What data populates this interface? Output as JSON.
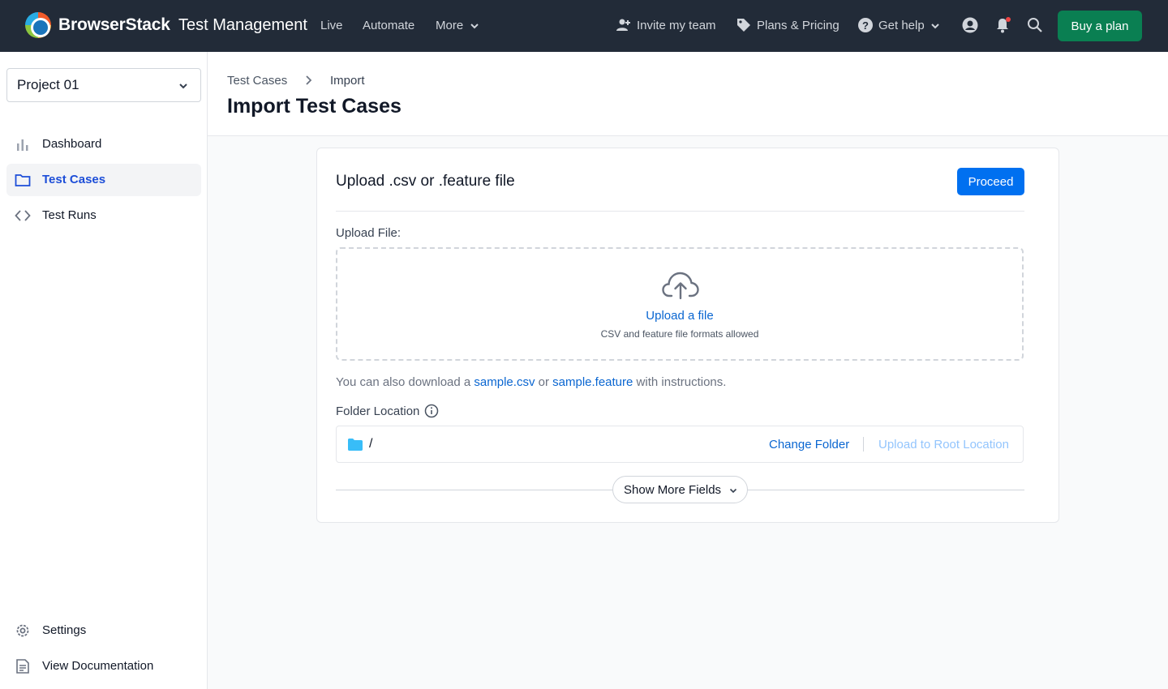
{
  "topbar": {
    "brand": "BrowserStack",
    "product": "Test Management",
    "nav": [
      "Live",
      "Automate",
      "More"
    ],
    "invite": "Invite my team",
    "plans": "Plans & Pricing",
    "help": "Get help",
    "buy_label": "Buy a plan",
    "colors": {
      "bar": "#222b38",
      "buy": "#0a7f52"
    }
  },
  "sidebar": {
    "project": "Project 01",
    "items": [
      {
        "label": "Dashboard",
        "icon": "bar-chart-icon"
      },
      {
        "label": "Test Cases",
        "icon": "folder-icon",
        "active": true
      },
      {
        "label": "Test Runs",
        "icon": "code-icon"
      }
    ],
    "bottom_items": [
      {
        "label": "Settings",
        "icon": "gear-icon"
      },
      {
        "label": "View Documentation",
        "icon": "document-icon"
      }
    ]
  },
  "header": {
    "breadcrumb": [
      "Test Cases",
      "Import"
    ],
    "title": "Import Test Cases"
  },
  "card": {
    "title": "Upload .csv or .feature file",
    "proceed_label": "Proceed",
    "upload_label": "Upload File:",
    "upload_link": "Upload a file",
    "upload_hint": "CSV and feature file formats allowed",
    "sample_prefix": "You can also download a",
    "sample_csv": "sample.csv",
    "sample_or": "or",
    "sample_feature": "sample.feature",
    "sample_suffix": "with instructions.",
    "folder_label": "Folder Location",
    "folder_path": "/",
    "change_folder": "Change Folder",
    "upload_root": "Upload to Root Location",
    "show_more": "Show More Fields",
    "accent": "#0070f0"
  }
}
